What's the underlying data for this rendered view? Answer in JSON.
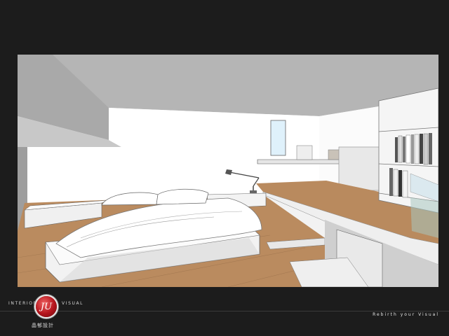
{
  "brand": {
    "left_word": "INTERIOR",
    "right_word": "VISUAL",
    "logo_text": "JU",
    "chinese_name": "晶郁設計"
  },
  "tagline": "Rebirth your Visual",
  "colors": {
    "frame": "#1c1c1c",
    "logo_red": "#b3141c",
    "wood_floor": "#b98a5e",
    "wall": "#ffffff",
    "ceiling": "#b3b3b3"
  },
  "scene": {
    "icons": [
      "bed-icon",
      "desk-lamp-icon",
      "bookshelf-icon",
      "window-icon",
      "desk-icon"
    ]
  }
}
